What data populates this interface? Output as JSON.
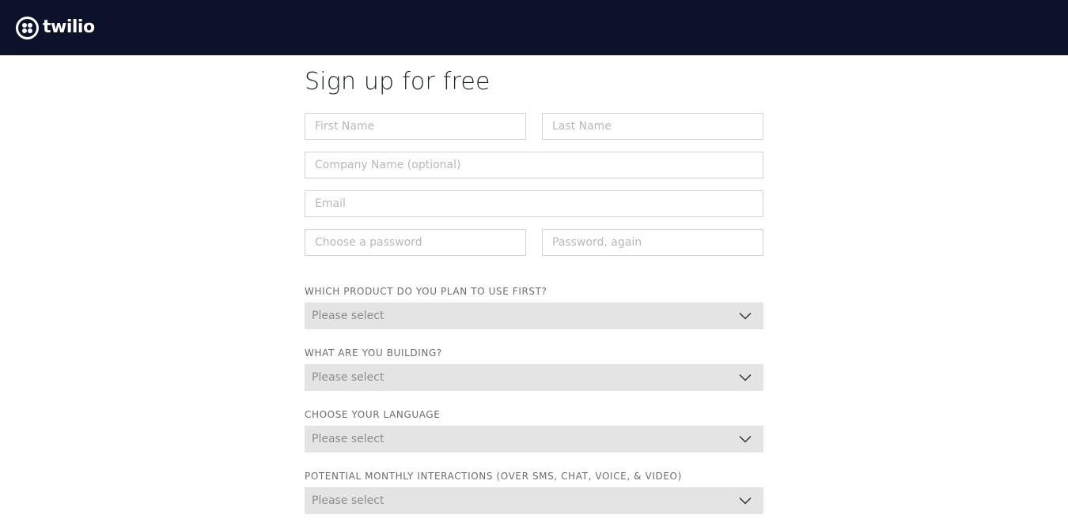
{
  "brand": {
    "name": "twilio",
    "header_bg": "#0d122b"
  },
  "page": {
    "title": "Sign up for free"
  },
  "form": {
    "first_name": {
      "placeholder": "First Name",
      "value": ""
    },
    "last_name": {
      "placeholder": "Last Name",
      "value": ""
    },
    "company": {
      "placeholder": "Company Name (optional)",
      "value": ""
    },
    "email": {
      "placeholder": "Email",
      "value": ""
    },
    "password": {
      "placeholder": "Choose a password",
      "value": ""
    },
    "password_again": {
      "placeholder": "Password, again",
      "value": ""
    },
    "questions": [
      {
        "label": "WHICH PRODUCT DO YOU PLAN TO USE FIRST?",
        "value": "Please select"
      },
      {
        "label": "WHAT ARE YOU BUILDING?",
        "value": "Please select"
      },
      {
        "label": "CHOOSE YOUR LANGUAGE",
        "value": "Please select"
      },
      {
        "label": "POTENTIAL MONTHLY INTERACTIONS (OVER SMS, CHAT, VOICE, & VIDEO)",
        "value": "Please select"
      }
    ]
  },
  "icons": {
    "logo": "twilio-logo-icon",
    "dropdown": "chevron-down-icon"
  }
}
